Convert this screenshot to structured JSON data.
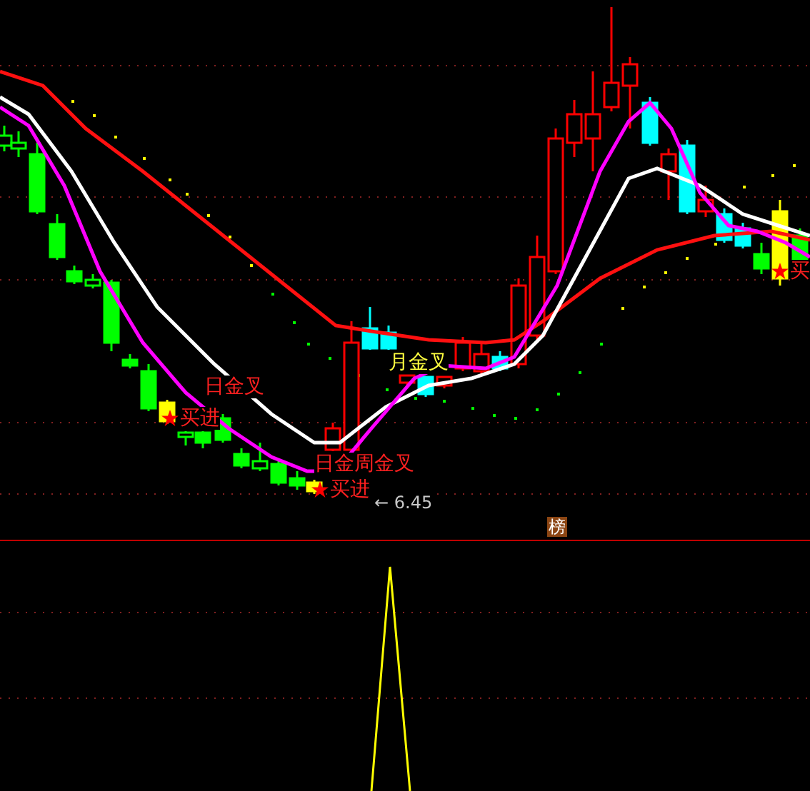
{
  "chart": {
    "signals": [
      {
        "kind": "buy",
        "text": "买"
      },
      {
        "kind": "month_cross",
        "text": "月金叉"
      },
      {
        "kind": "cross",
        "text": "日金叉"
      },
      {
        "kind": "buy",
        "text": "买进"
      },
      {
        "kind": "cross",
        "text": "日金周金叉"
      },
      {
        "kind": "buy",
        "text": "买进"
      },
      {
        "kind": "price",
        "text": "← 6.45"
      }
    ],
    "badge": "榜"
  }
}
